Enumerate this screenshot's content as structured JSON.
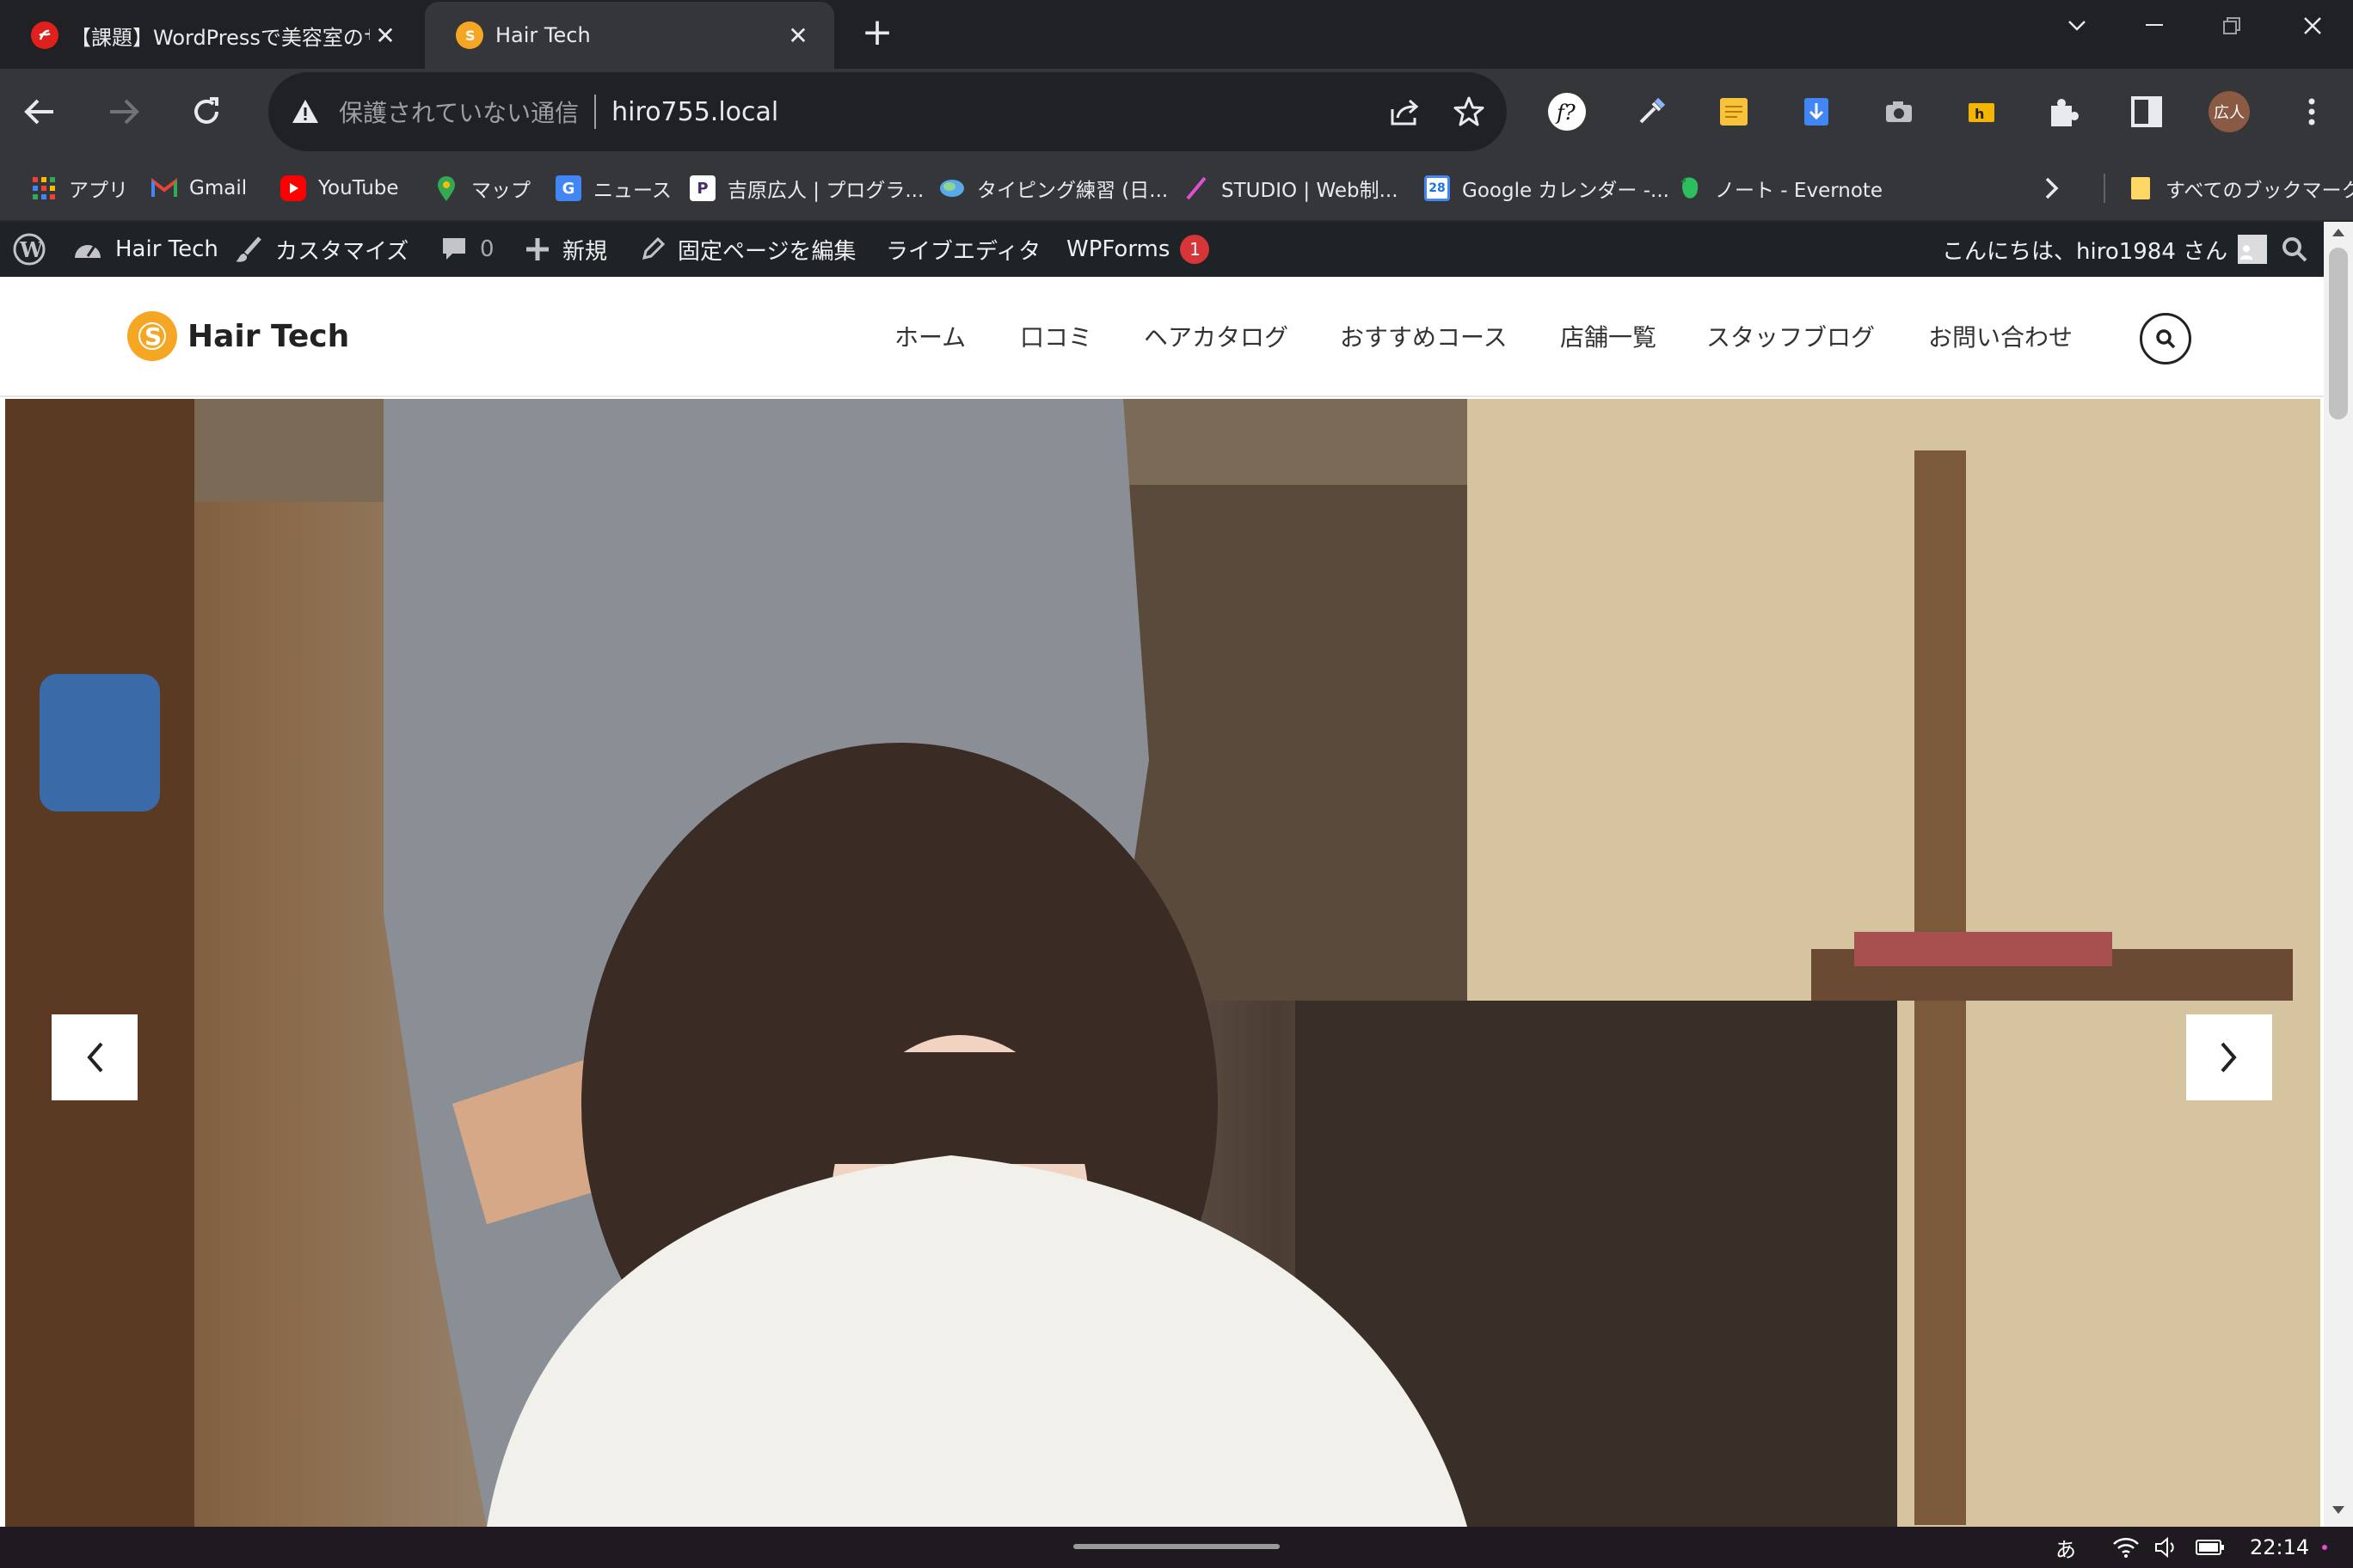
{
  "browser": {
    "tabs": [
      {
        "title": "【課題】WordPressで美容室のサ",
        "active": false,
        "favicon": "red-icon"
      },
      {
        "title": "Hair Tech",
        "active": true,
        "favicon": "hairtech-logo-icon"
      }
    ],
    "address": {
      "security": "保護されていない通信",
      "url": "hiro755.local"
    },
    "profile_label": "広人",
    "bookmarks": [
      {
        "label": "アプリ",
        "icon": "apps-grid-icon"
      },
      {
        "label": "Gmail",
        "icon": "gmail-icon"
      },
      {
        "label": "YouTube",
        "icon": "youtube-icon"
      },
      {
        "label": "マップ",
        "icon": "maps-icon"
      },
      {
        "label": "ニュース",
        "icon": "news-icon"
      },
      {
        "label": "吉原広人 | プログラ...",
        "icon": "p-icon"
      },
      {
        "label": "タイピング練習 (日...",
        "icon": "globe-icon"
      },
      {
        "label": "STUDIO | Web制...",
        "icon": "studio-icon"
      },
      {
        "label": "Google カレンダー -...",
        "icon": "calendar-icon"
      },
      {
        "label": "ノート - Evernote",
        "icon": "evernote-icon"
      }
    ],
    "all_bookmarks": "すべてのブックマーク",
    "calendar_day": "28"
  },
  "wp_admin": {
    "site_name": "Hair Tech",
    "customize": "カスタマイズ",
    "comments": "0",
    "new": "新規",
    "edit_page": "固定ページを編集",
    "live_editor": "ライブエディタ",
    "wpforms": "WPForms",
    "wpforms_count": "1",
    "greeting": "こんにちは、hiro1984 さん"
  },
  "site": {
    "logo_text": "Hair Tech",
    "nav": [
      "ホーム",
      "口コミ",
      "ヘアカタログ",
      "おすすめコース",
      "店舗一覧",
      "スタッフブログ",
      "お問い合わせ"
    ]
  },
  "taskbar": {
    "ime": "あ",
    "time": "22:14"
  },
  "colors": {
    "accent": "#f5a623",
    "admin_bar": "#1d2327",
    "badge": "#d63638"
  }
}
